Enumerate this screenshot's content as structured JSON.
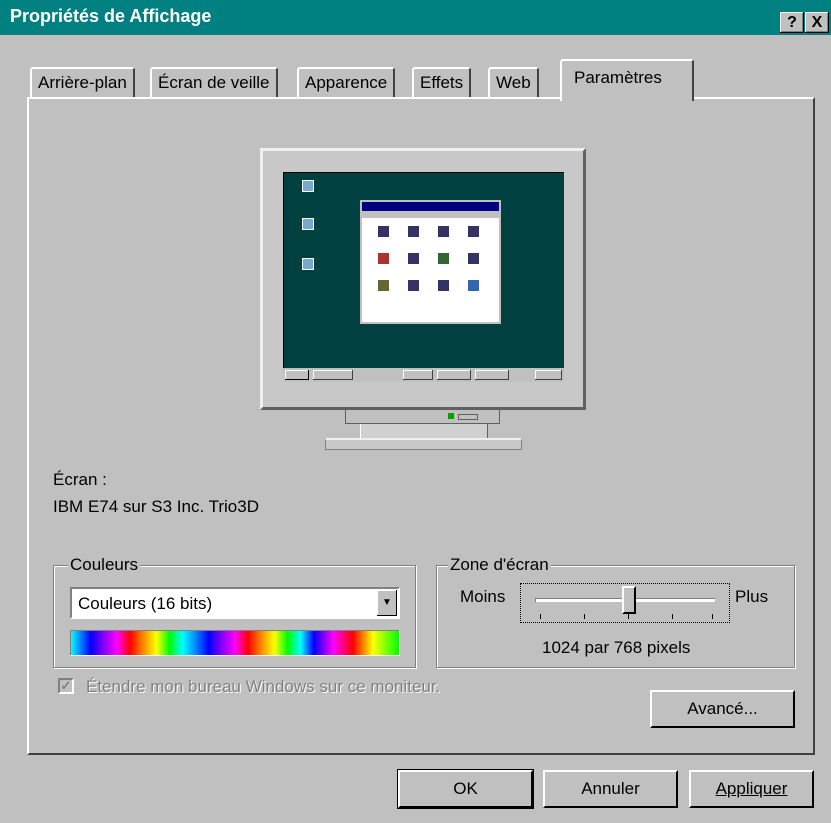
{
  "window": {
    "title": "Propriétés de Affichage",
    "help_glyph": "?",
    "close_glyph": "X"
  },
  "tabs": [
    {
      "label": "Arrière-plan"
    },
    {
      "label": "Écran de veille"
    },
    {
      "label": "Apparence"
    },
    {
      "label": "Effets"
    },
    {
      "label": "Web"
    },
    {
      "label": "Paramètres",
      "active": true
    }
  ],
  "display": {
    "label": "Écran :",
    "device": "IBM E74 sur S3 Inc. Trio3D"
  },
  "colors": {
    "group_label": "Couleurs",
    "selected": "Couleurs (16 bits)"
  },
  "screen_area": {
    "group_label": "Zone d'écran",
    "less_label": "Moins",
    "more_label": "Plus",
    "resolution_text": "1024 par 768 pixels",
    "slider_position_fraction": 0.52
  },
  "extend_desktop": {
    "label": "Étendre mon bureau Windows sur ce moniteur.",
    "checked": true,
    "enabled": false
  },
  "buttons": {
    "advanced": "Avancé...",
    "ok": "OK",
    "cancel": "Annuler",
    "apply": "Appliquer"
  },
  "theme": {
    "title_bar_color": "#008080",
    "desktop_preview_color": "#004040",
    "face_color": "#c0c0c0"
  }
}
